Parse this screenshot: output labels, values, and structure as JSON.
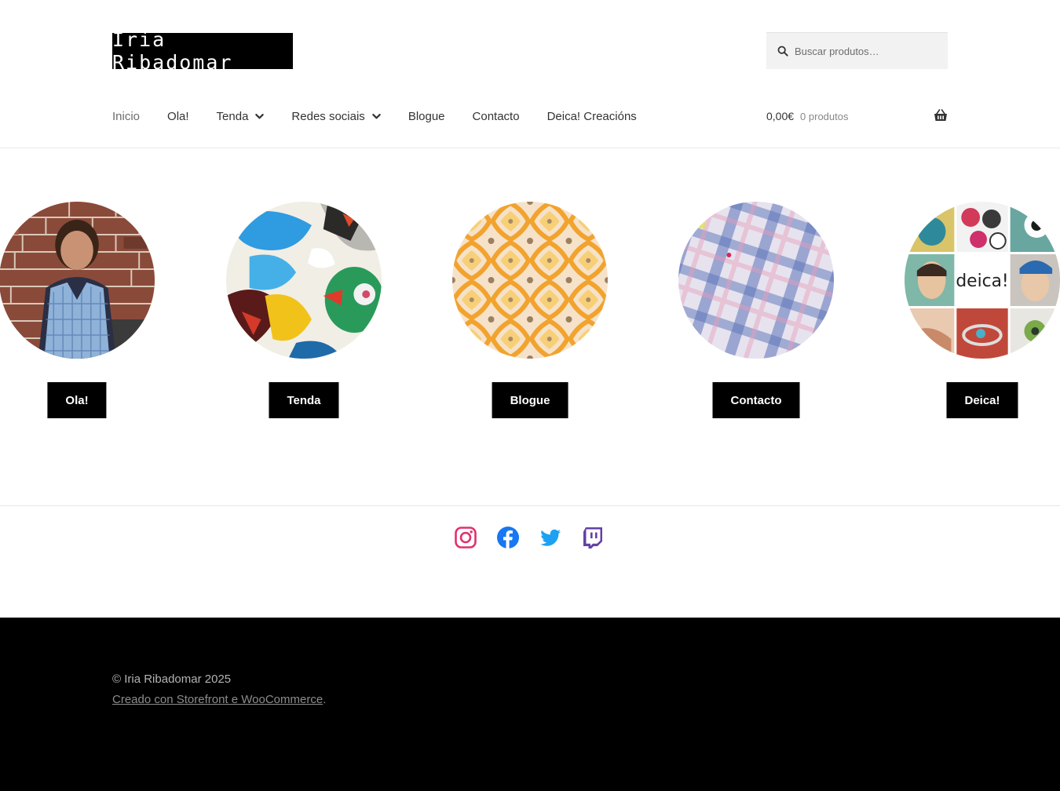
{
  "site": {
    "logo_text": "Iria Ribadomar"
  },
  "search": {
    "placeholder": "Buscar produtos…",
    "icon": "search-icon"
  },
  "nav": {
    "items": [
      {
        "label": "Inicio",
        "active": true
      },
      {
        "label": "Ola!"
      },
      {
        "label": "Tenda",
        "dropdown": true
      },
      {
        "label": "Redes sociais",
        "dropdown": true
      },
      {
        "label": "Blogue"
      },
      {
        "label": "Contacto"
      },
      {
        "label": "Deica! Creacións"
      }
    ]
  },
  "cart": {
    "total": "0,00€",
    "count": "0 produtos",
    "icon": "basket-icon"
  },
  "cards": [
    {
      "button": "Ola!",
      "image": "portrait-photo"
    },
    {
      "button": "Tenda",
      "image": "paint-texture"
    },
    {
      "button": "Blogue",
      "image": "orange-tile-pattern"
    },
    {
      "button": "Contacto",
      "image": "plaid-fabric"
    },
    {
      "button": "Deica!",
      "image": "deica-collage",
      "image_text": "deica!"
    }
  ],
  "socials": [
    {
      "name": "Instagram",
      "icon": "instagram-icon",
      "color": "#e1306c"
    },
    {
      "name": "Facebook",
      "icon": "facebook-icon",
      "color": "#1877f2"
    },
    {
      "name": "Twitter",
      "icon": "twitter-icon",
      "color": "#1da1f2"
    },
    {
      "name": "Twitch",
      "icon": "twitch-icon",
      "color": "#6441a5"
    }
  ],
  "footer": {
    "copyright": "© Iria Ribadomar 2025",
    "credit_link": "Creado con Storefront e WooCommerce",
    "credit_end": "."
  }
}
